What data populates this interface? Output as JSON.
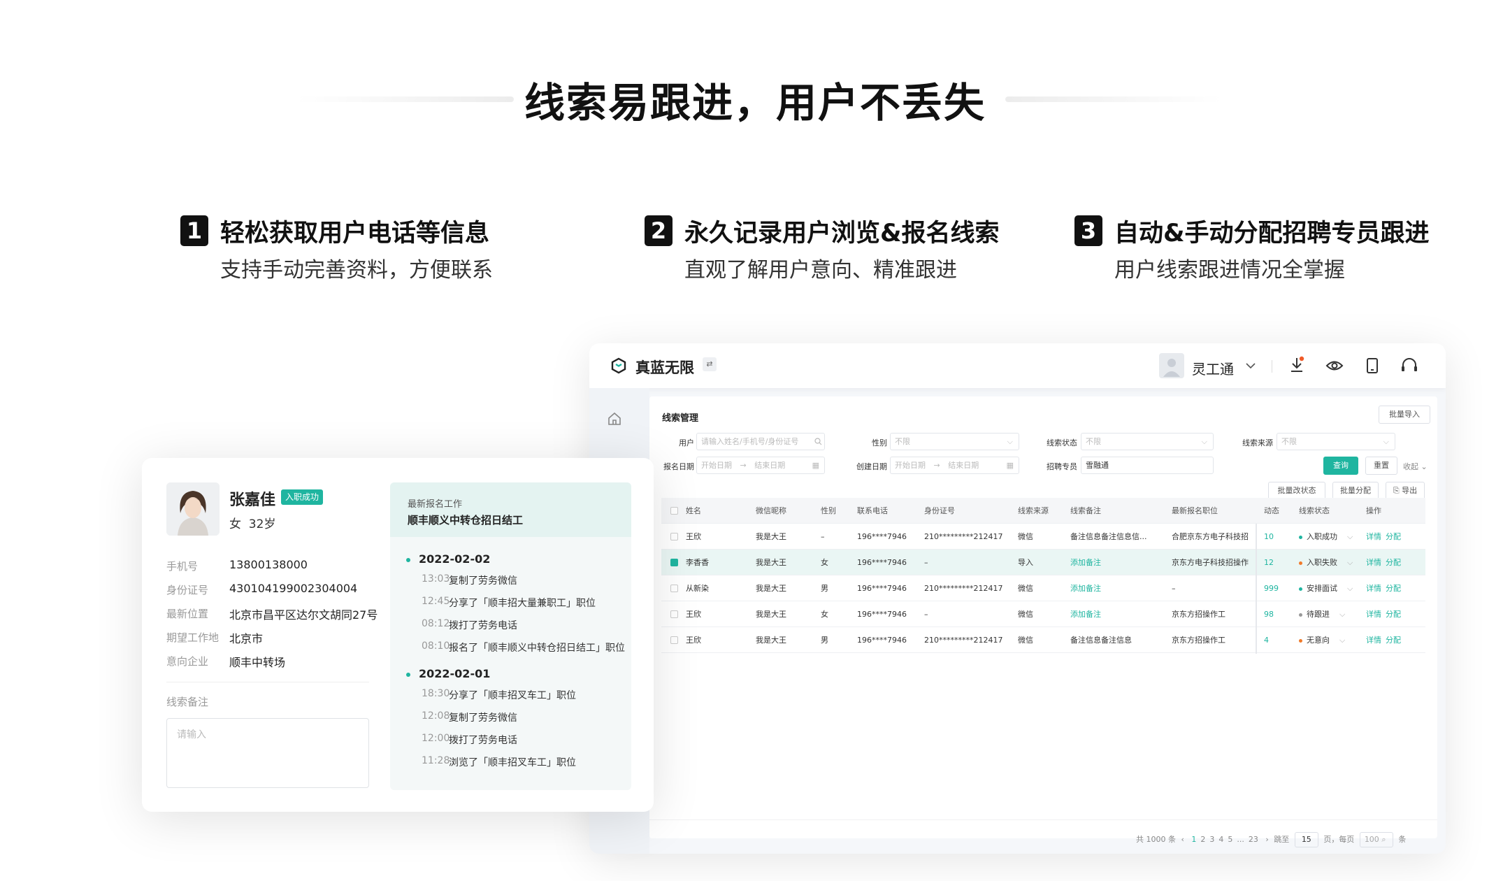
{
  "hero": {
    "title": "线索易跟进，用户不丢失"
  },
  "features": [
    {
      "num": "1",
      "title": "轻松获取用户电话等信息",
      "sub": "支持手动完善资料，方便联系"
    },
    {
      "num": "2",
      "title": "永久记录用户浏览&报名线索",
      "sub": "直观了解用户意向、精准跟进"
    },
    {
      "num": "3",
      "title": "自动&手动分配招聘专员跟进",
      "sub": "用户线索跟进情况全掌握"
    }
  ],
  "app": {
    "brand": "真蓝无限",
    "switch_icon": "⇄",
    "user": "灵工通",
    "colors": {
      "accent": "#1fb5a0",
      "success": "#1fb5a0",
      "fail": "#f07a2a",
      "pending": "#999999"
    },
    "page_title": "线索管理",
    "batch_import": "批量导入",
    "filters": {
      "user_label": "用户",
      "user_placeholder": "请输入姓名/手机号/身份证号",
      "gender_label": "性别",
      "gender_value": "不限",
      "status_label": "线索状态",
      "status_value": "不限",
      "source_label": "线索来源",
      "source_value": "不限",
      "signup_label": "报名日期",
      "start_date": "开始日期",
      "arrow": "→",
      "end_date": "结束日期",
      "created_label": "创建日期",
      "recruiter_label": "招聘专员",
      "recruiter_value": "雪融通",
      "query": "查询",
      "reset": "重置",
      "collapse": "收起"
    },
    "actions": {
      "batch_status": "批量改状态",
      "batch_assign": "批量分配",
      "export": "导出"
    },
    "table": {
      "headers": [
        "姓名",
        "微信昵称",
        "性别",
        "联系电话",
        "身份证号",
        "线索来源",
        "线索备注",
        "最新报名职位",
        "动态",
        "线索状态",
        "操作"
      ],
      "rows": [
        {
          "name": "王欣",
          "wechat": "我是大王",
          "gender": "–",
          "phone": "196****7946",
          "id": "210*********212417",
          "source": "微信",
          "note": "备注信息备注信息信...",
          "note_link": false,
          "job": "合肥京东方电子科技招",
          "dyn": "10",
          "status": "入职成功",
          "status_color": "#1fb5a0",
          "checked": false,
          "op1": "详情",
          "op2": "分配"
        },
        {
          "name": "李香香",
          "wechat": "我是大王",
          "gender": "女",
          "phone": "196****7946",
          "id": "–",
          "source": "导入",
          "note": "添加备注",
          "note_link": true,
          "job": "京东方电子科技招操作",
          "dyn": "12",
          "status": "入职失败",
          "status_color": "#f07a2a",
          "checked": true,
          "op1": "详情",
          "op2": "分配"
        },
        {
          "name": "从新染",
          "wechat": "我是大王",
          "gender": "男",
          "phone": "196****7946",
          "id": "210*********212417",
          "source": "微信",
          "note": "添加备注",
          "note_link": true,
          "job": "–",
          "dyn": "999",
          "status": "安排面试",
          "status_color": "#1fb5a0",
          "checked": false,
          "op1": "详情",
          "op2": "分配"
        },
        {
          "name": "王欣",
          "wechat": "我是大王",
          "gender": "女",
          "phone": "196****7946",
          "id": "–",
          "source": "微信",
          "note": "添加备注",
          "note_link": true,
          "job": "京东方招操作工",
          "dyn": "98",
          "status": "待跟进",
          "status_color": "#999999",
          "checked": false,
          "op1": "详情",
          "op2": "分配"
        },
        {
          "name": "王欣",
          "wechat": "我是大王",
          "gender": "男",
          "phone": "196****7946",
          "id": "210*********212417",
          "source": "微信",
          "note": "备注信息备注信息",
          "note_link": false,
          "job": "京东方招操作工",
          "dyn": "4",
          "status": "无意向",
          "status_color": "#f07a2a",
          "checked": false,
          "op1": "详情",
          "op2": "分配"
        }
      ]
    },
    "pagination": {
      "total": "共 1000 条",
      "pages": [
        "1",
        "2",
        "3",
        "4",
        "5",
        "...",
        "23"
      ],
      "goto": "跳至",
      "goto_value": "15",
      "per_page": "页，每页",
      "per_value": "100",
      "unit": "条"
    }
  },
  "card": {
    "name": "张嘉佳",
    "badge": "入职成功",
    "meta": "女  32岁",
    "fields": [
      {
        "label": "手机号",
        "value": "13800138000"
      },
      {
        "label": "身份证号",
        "value": "430104199002304004"
      },
      {
        "label": "最新位置",
        "value": "北京市昌平区达尔文胡同27号"
      },
      {
        "label": "期望工作地",
        "value": "北京市"
      },
      {
        "label": "意向企业",
        "value": "顺丰中转场"
      }
    ],
    "note_label": "线索备注",
    "note_placeholder": "请输入",
    "latest_label": "最新报名工作",
    "latest_job": "顺丰顺义中转仓招日结工",
    "days": [
      {
        "date": "2022-02-02",
        "events": [
          {
            "time": "13:03",
            "desc": "复制了劳务微信"
          },
          {
            "time": "12:45",
            "desc": "分享了「顺丰招大量兼职工」职位"
          },
          {
            "time": "08:12",
            "desc": "拨打了劳务电话"
          },
          {
            "time": "08:10",
            "desc": "报名了「顺丰顺义中转仓招日结工」职位"
          }
        ]
      },
      {
        "date": "2022-02-01",
        "events": [
          {
            "time": "18:30",
            "desc": "分享了「顺丰招叉车工」职位"
          },
          {
            "time": "12:08",
            "desc": "复制了劳务微信"
          },
          {
            "time": "12:00",
            "desc": "拨打了劳务电话"
          },
          {
            "time": "11:28",
            "desc": "浏览了「顺丰招叉车工」职位"
          }
        ]
      }
    ]
  }
}
